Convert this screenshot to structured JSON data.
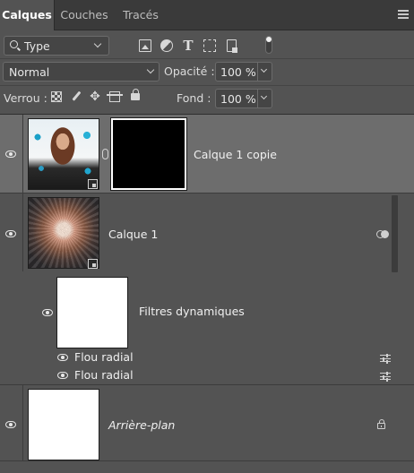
{
  "tabs": [
    {
      "label": "Calques",
      "active": true
    },
    {
      "label": "Couches",
      "active": false
    },
    {
      "label": "Tracés",
      "active": false
    }
  ],
  "filter": {
    "kind_label": "Type",
    "icons": [
      "image-filter-icon",
      "adjustment-filter-icon",
      "type-filter-icon",
      "shape-filter-icon",
      "smart-object-filter-icon"
    ]
  },
  "blend": {
    "mode": "Normal",
    "opacity_label": "Opacité :",
    "opacity_value": "100 %"
  },
  "lock": {
    "label": "Verrou :",
    "fill_label": "Fond :",
    "fill_value": "100 %"
  },
  "layers": [
    {
      "name": "Calque 1 copie",
      "selected": true,
      "visible": true,
      "smart_object": true,
      "has_mask": true
    },
    {
      "name": "Calque 1",
      "selected": false,
      "visible": true,
      "smart_object": true,
      "has_smart_filters": true
    },
    {
      "name": "Filtres dynamiques",
      "type": "smart-filters-group",
      "visible": true
    },
    {
      "name": "Flou radial",
      "type": "smart-filter",
      "visible": true
    },
    {
      "name": "Flou radial",
      "type": "smart-filter",
      "visible": true
    },
    {
      "name": "Arrière-plan",
      "selected": false,
      "visible": true,
      "locked": true,
      "italic": true
    }
  ],
  "colors": {
    "panel_bg": "#535353",
    "tabbar_bg": "#3a3a3a",
    "selected_row": "#6d6d6d",
    "text": "#e6e6e6"
  }
}
